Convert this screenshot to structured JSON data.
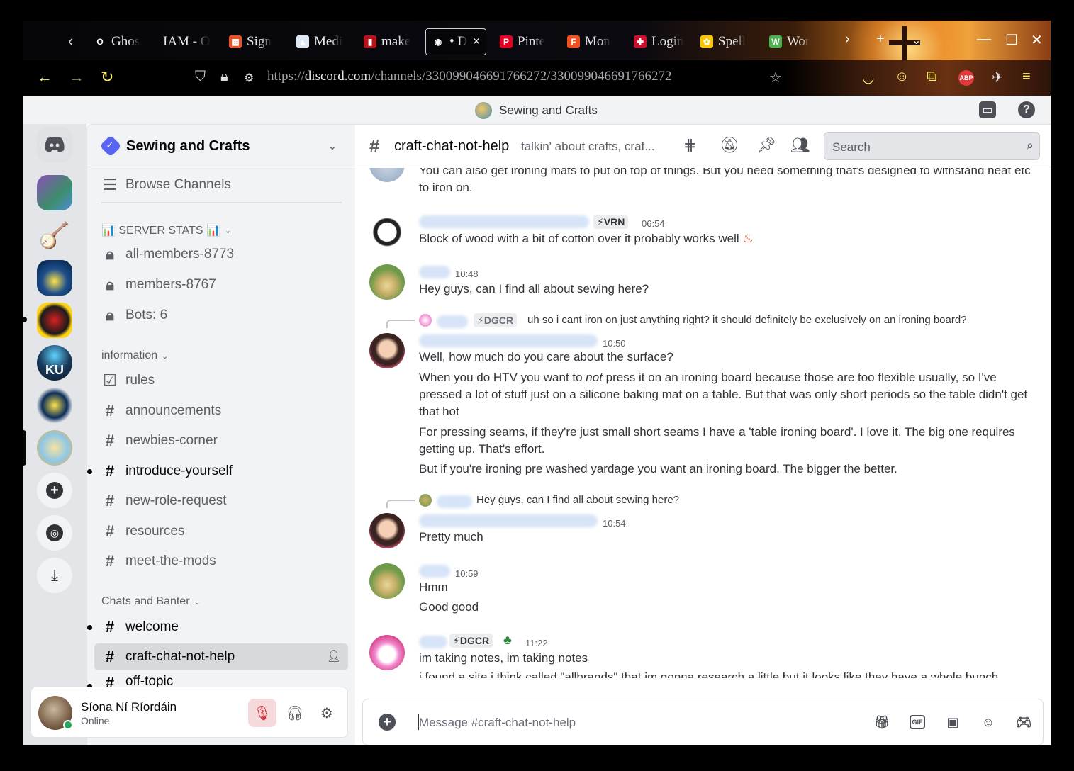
{
  "browser": {
    "tabs": [
      {
        "title": "Ghos",
        "fav_color": "#ffffff",
        "fav_text": "O"
      },
      {
        "title": "IAM - O",
        "fav_color": "",
        "fav_text": ""
      },
      {
        "title": "Sign",
        "fav_color": "#f25022",
        "fav_text": "▦"
      },
      {
        "title": "Medi",
        "fav_color": "#dfe8f5",
        "fav_text": "▲"
      },
      {
        "title": "make",
        "fav_color": "#b8131a",
        "fav_text": "▮"
      },
      {
        "title": "• D",
        "fav_color": "#ffffff",
        "fav_text": "◉"
      },
      {
        "title": "Pinte",
        "fav_color": "#e60023",
        "fav_text": "P"
      },
      {
        "title": "Mon",
        "fav_color": "#f04e23",
        "fav_text": "F"
      },
      {
        "title": "Login",
        "fav_color": "#c8102e",
        "fav_text": "✚"
      },
      {
        "title": "Spell",
        "fav_color": "#f7c600",
        "fav_text": "✿"
      },
      {
        "title": "Wor",
        "fav_color": "#4caf50",
        "fav_text": "W"
      }
    ],
    "url_prefix": "https://",
    "url_domain": "discord.com",
    "url_path": "/channels/330099046691766272/330099046691766272",
    "abp_label": "ABP"
  },
  "app": {
    "window_title": "Sewing and Crafts"
  },
  "sidebar": {
    "server_name": "Sewing and Crafts",
    "browse": "Browse Channels",
    "stats_category": "📊 SERVER STATS 📊",
    "stats": [
      "all-members-8773",
      "members-8767",
      "Bots: 6"
    ],
    "info_category": "information",
    "info_channels": [
      "rules",
      "announcements",
      "newbies-corner",
      "introduce-yourself",
      "new-role-request",
      "resources",
      "meet-the-mods"
    ],
    "chats_category": "Chats and Banter",
    "chats_channels": [
      "welcome",
      "craft-chat-not-help",
      "off-topic"
    ]
  },
  "user": {
    "name": "Síona Ní Ríordáin",
    "status": "Online"
  },
  "channel": {
    "name": "craft-chat-not-help",
    "topic": "talkin' about crafts, craf...",
    "search_placeholder": "Search",
    "composer_placeholder": "Message #craft-chat-not-help"
  },
  "messages": {
    "m0_line": "You can also get ironing mats to put on top of things. But you need something that's designed to withstand heat etc to iron on.",
    "m1_tag": "⚡VRN",
    "m1_time": "06:54",
    "m1_text": "Block of wood with a bit of cotton over it probably works well",
    "m2_time": "10:48",
    "m2_text": "Hey guys, can I find all about sewing here?",
    "m3_reply_tag": "⚡DGCR",
    "m3_reply_text": "uh so i cant iron on just anything right? it should definitely be exclusively on an ironing board?",
    "m3_time": "10:50",
    "m3_p1": "Well, how much do you care about the surface?",
    "m3_p2a": "When you do HTV you want to ",
    "m3_p2em": "not",
    "m3_p2b": " press it on an ironing board because those are too flexible usually, so I've pressed a lot of stuff just on a silicone baking mat on a table. But that was only short periods so the table didn't get that hot",
    "m3_p3": "For pressing seams, if they're just small short seams I have a 'table ironing board'. I love it. The big one requires getting up. That's effort.",
    "m3_p4": "But if you're ironing pre washed yardage you want an ironing board. The bigger the better.",
    "m4_reply_text": "Hey guys, can I find all about sewing here?",
    "m4_time": "10:54",
    "m4_text": "Pretty much",
    "m5_time": "10:59",
    "m5_p1": "Hmm",
    "m5_p2": "Good good",
    "m6_tag": "⚡DGCR",
    "m6_time": "11:22",
    "m6_p1": "im taking notes, im taking notes",
    "m6_p2": "i found a site i think called \"allbrands\" that im gonna research a little but it looks like they have a whole bunch"
  },
  "colors": {
    "accent": "#5865f2",
    "online": "#23a55a",
    "mute": "#da373c"
  }
}
